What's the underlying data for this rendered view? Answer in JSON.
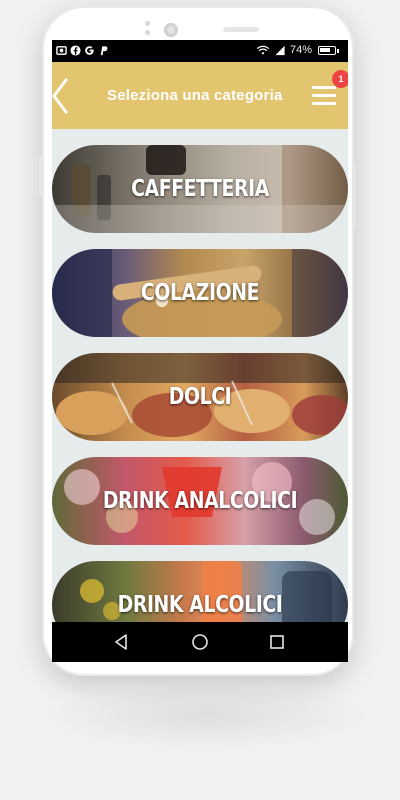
{
  "status_bar": {
    "battery": "74%",
    "battery_level": 0.74
  },
  "header": {
    "title": "Seleziona una categoria",
    "badge_count": "1"
  },
  "categories": [
    {
      "label": "CAFFETTERIA"
    },
    {
      "label": "COLAZIONE"
    },
    {
      "label": "DOLCI"
    },
    {
      "label": "DRINK ANALCOLICI"
    },
    {
      "label": "DRINK ALCOLICI"
    }
  ],
  "colors": {
    "header": "#e3c46f",
    "background": "#e6ecec",
    "badge": "#ef4444"
  },
  "icons": {
    "back": "chevron-left-icon",
    "menu": "hamburger-menu-icon",
    "nav_back": "triangle-back-icon",
    "nav_home": "circle-home-icon",
    "nav_recents": "square-recents-icon"
  }
}
